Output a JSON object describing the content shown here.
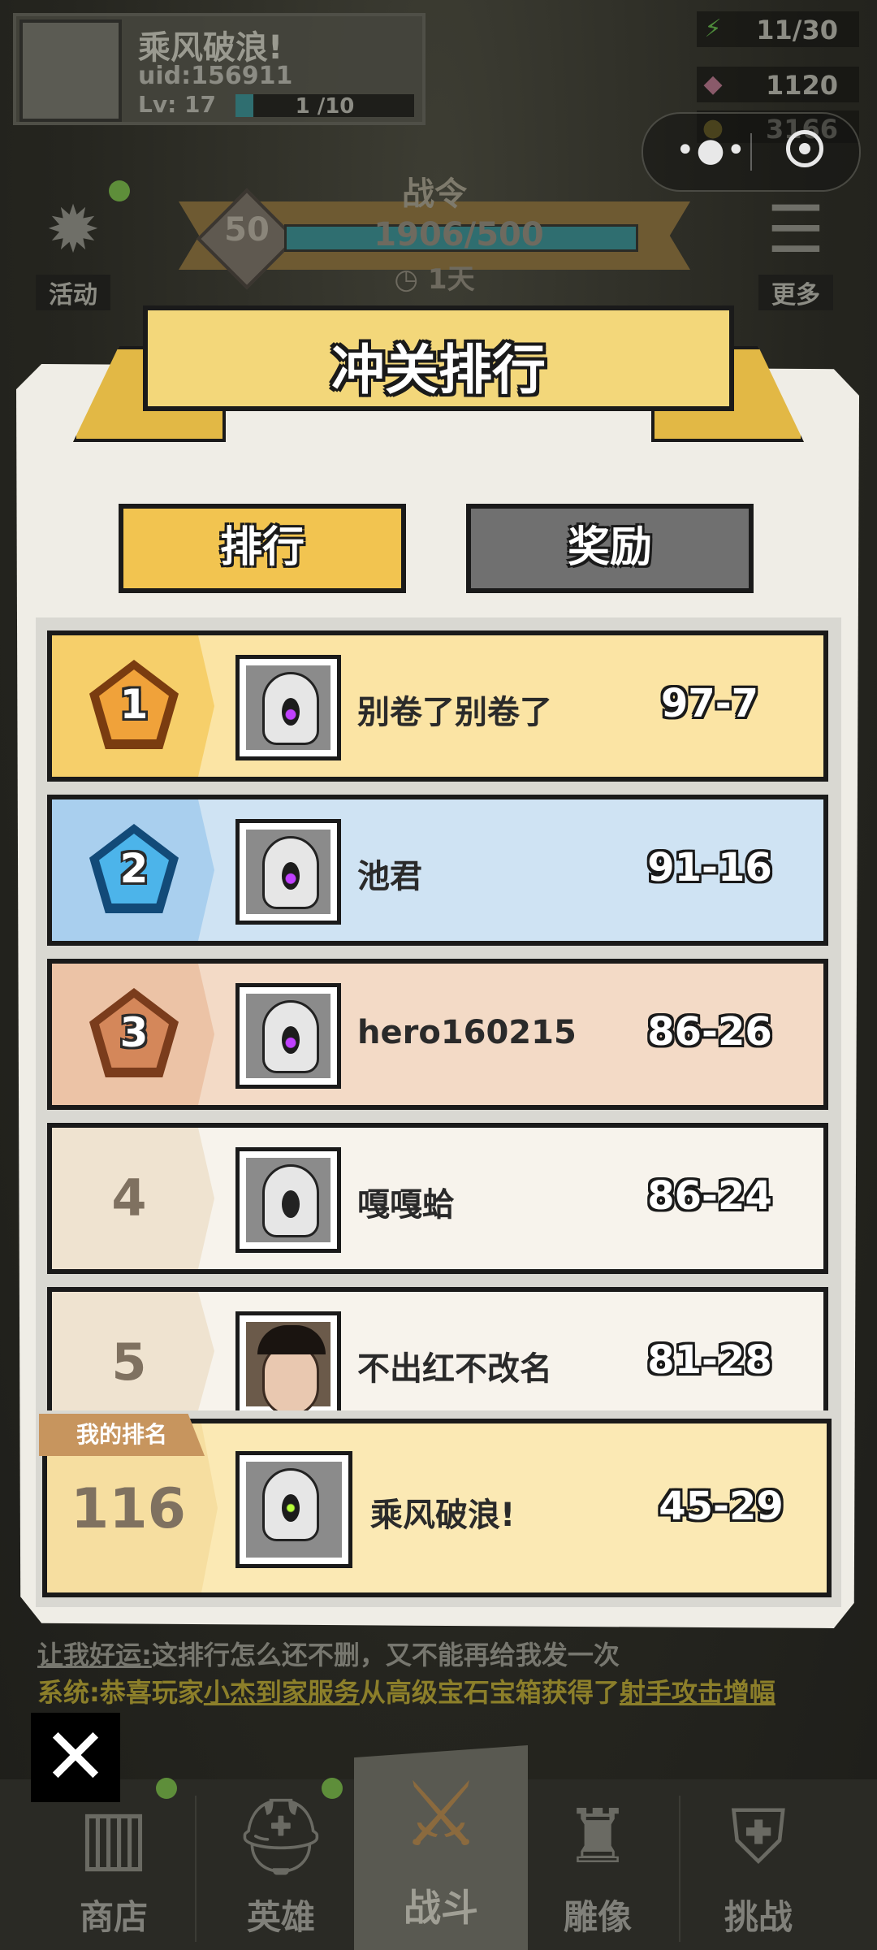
{
  "player": {
    "name": "乘风破浪!",
    "uid": "uid:156911",
    "level": "Lv: 17",
    "exp_text": "1 /10",
    "exp_fraction": 0.1
  },
  "resources": {
    "energy": "11/30",
    "gems": "1120",
    "gold": "3166"
  },
  "side_buttons": {
    "activity": "活动",
    "more": "更多"
  },
  "battle_pass": {
    "title": "战令",
    "level": "50",
    "exp": "1906/500",
    "time_left": "1天"
  },
  "modal": {
    "title": "冲关排行",
    "tabs": {
      "rank": "排行",
      "reward": "奖励"
    }
  },
  "rankings": [
    {
      "rank": "1",
      "name": "别卷了别卷了",
      "score": "97-7"
    },
    {
      "rank": "2",
      "name": "池君",
      "score": "91-16"
    },
    {
      "rank": "3",
      "name": "hero160215",
      "score": "86-26"
    },
    {
      "rank": "4",
      "name": "嘎嘎蛤",
      "score": "86-24"
    },
    {
      "rank": "5",
      "name": "不出红不改名",
      "score": "81-28"
    }
  ],
  "my_rank": {
    "tag": "我的排名",
    "rank": "116",
    "name": "乘风破浪!",
    "score": "45-29"
  },
  "chat": {
    "line1_name": "让我好运:",
    "line1_text": "这排行怎么还不删，又不能再给我发一次",
    "line2_prefix": "系统:",
    "line2_a": "恭喜玩家",
    "line2_player": "小杰到家服务",
    "line2_b": "从高级宝石宝箱获得了",
    "line2_item": "射手攻击增幅"
  },
  "nav": {
    "shop": "商店",
    "hero": "英雄",
    "battle": "战斗",
    "statue": "雕像",
    "challenge": "挑战"
  },
  "colors": {
    "rank1": "#fbe4a4",
    "rank2": "#cfe3f3",
    "rank3": "#f3dac6",
    "rank_other": "#f7f3ec"
  }
}
